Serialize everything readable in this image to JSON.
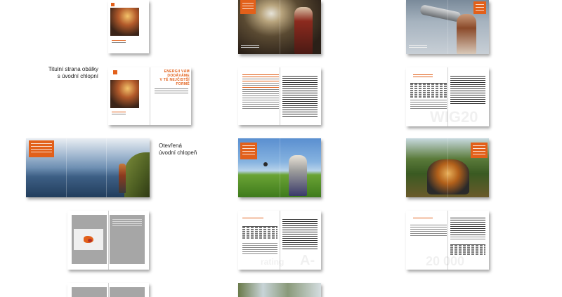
{
  "captions": {
    "cover": "Titulní strana obálky\ns úvodní chlopní",
    "flap": "Otevřená\núvodní chlopeň"
  },
  "cover_headline": "ENERGII VÁM\nDODÁVÁME\nV TÉ NEJČISTŠÍ\nFORMĚ",
  "ghost_texts": {
    "wig": "WIG20",
    "rating": "rating",
    "rating_suffix": "A-",
    "number": "20 000"
  },
  "colors": {
    "accent": "#e2601a",
    "shadow": "#00000059"
  }
}
